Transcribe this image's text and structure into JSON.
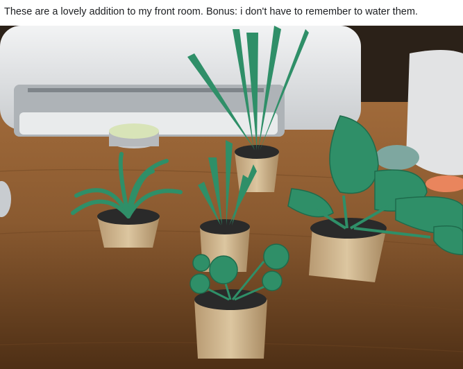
{
  "post": {
    "caption": "These are a lovely addition to my front room. Bonus: i don't have to remember to water them."
  },
  "photo": {
    "subject": "paper-craft-potted-plants",
    "colors": {
      "table": "#8a5a30",
      "table_dark": "#4e2f15",
      "leaf": "#2f8f68",
      "leaf_dark": "#1e6b4c",
      "pot": "#cdb48f",
      "printer": "#e4e6e8"
    }
  }
}
